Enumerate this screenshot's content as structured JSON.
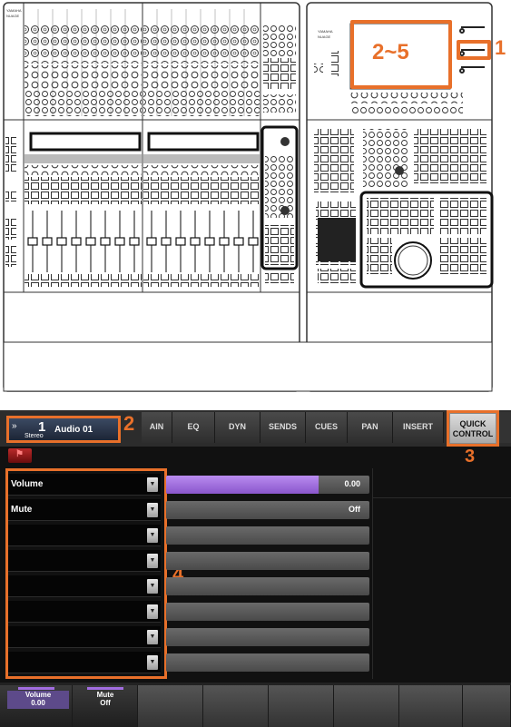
{
  "console": {
    "left_brand": "YAMAHA NUAGE",
    "right_brand": "YAMAHA NUAGE"
  },
  "callouts": {
    "c1": "1",
    "c2_5": "2~5",
    "c2": "2",
    "c3": "3",
    "c4": "4"
  },
  "screen": {
    "track": {
      "number": "1",
      "type": "Stereo",
      "name": "Audio 01"
    },
    "tabs": [
      "AIN",
      "EQ",
      "DYN",
      "SENDS",
      "CUES",
      "PAN",
      "INSERT"
    ],
    "quick_control": {
      "line1": "QUICK",
      "line2": "CONTROL"
    },
    "parameters": [
      {
        "label": "Volume",
        "value": "0.00",
        "fill": 0.75
      },
      {
        "label": "Mute",
        "value": "Off",
        "fill": 0
      },
      {
        "label": "",
        "value": "",
        "fill": 0
      },
      {
        "label": "",
        "value": "",
        "fill": 0
      },
      {
        "label": "",
        "value": "",
        "fill": 0
      },
      {
        "label": "",
        "value": "",
        "fill": 0
      },
      {
        "label": "",
        "value": "",
        "fill": 0
      },
      {
        "label": "",
        "value": "",
        "fill": 0
      }
    ],
    "bottom": [
      {
        "label": "Volume",
        "value": "0.00"
      },
      {
        "label": "Mute",
        "value": "Off"
      }
    ],
    "accent_purple": "#a26de0",
    "callout_orange": "#e8702a"
  }
}
